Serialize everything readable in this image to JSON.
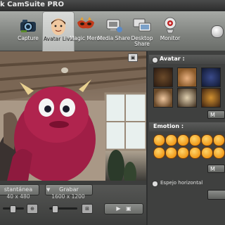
{
  "window": {
    "title": "k CamSuite PRO"
  },
  "toolbar": {
    "items": [
      {
        "label": "Capture",
        "icon": "camera-icon"
      },
      {
        "label": "Avatar Live",
        "icon": "avatar-face-icon"
      },
      {
        "label": "Magic Meror",
        "icon": "mask-icon"
      },
      {
        "label": "Media Share",
        "icon": "media-share-icon"
      },
      {
        "label": "Desktop Share",
        "icon": "desktop-share-icon"
      },
      {
        "label": "Monitor",
        "icon": "webcam-monitor-icon"
      }
    ],
    "selected": "Avatar Live"
  },
  "controls": {
    "snapshot_label": "stantánea",
    "record_label": "Grabar",
    "snapshot_res": "40 x 480",
    "record_res": "1600 x 1200"
  },
  "panel": {
    "avatar_header": "Avatar :",
    "emotion_header": "Emotion :",
    "mirror_label": "Espejo horizontal",
    "more_label": "M"
  }
}
